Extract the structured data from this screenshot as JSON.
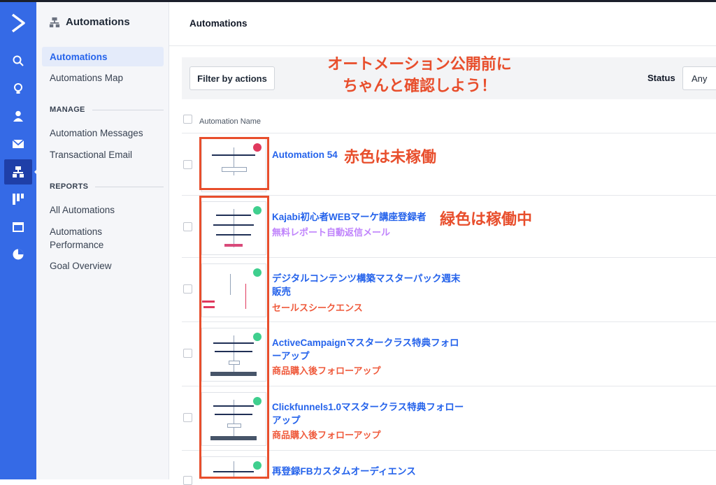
{
  "sidebar": {
    "title": "Automations",
    "items": [
      {
        "label": "Automations",
        "active": true
      },
      {
        "label": "Automations Map"
      }
    ],
    "manage_heading": "MANAGE",
    "manage_items": [
      "Automation Messages",
      "Transactional Email"
    ],
    "reports_heading": "REPORTS",
    "reports_items": [
      "All Automations",
      "Automations Performance",
      "Goal Overview"
    ]
  },
  "rail_icons": [
    "activecampaign-logo",
    "search-icon",
    "lightbulb-icon",
    "contacts-icon",
    "email-icon",
    "automations-icon",
    "pipeline-icon",
    "website-icon",
    "reports-icon"
  ],
  "page": {
    "title": "Automations"
  },
  "filter": {
    "button": "Filter by actions",
    "status_label": "Status",
    "status_value": "Any"
  },
  "table": {
    "column_name": "Automation Name"
  },
  "annotations": {
    "top_line1": "オートメーション公開前に",
    "top_line2": "ちゃんと確認しよう！",
    "red_note": "赤色は未稼働",
    "green_note": "緑色は稼働中"
  },
  "colors": {
    "accent": "#356ae6",
    "link": "#2563eb",
    "annotation": "#e84e2c",
    "inactive": "#e0395d",
    "active": "#3fcf8e"
  },
  "rows": [
    {
      "name": "Automation 54",
      "label": "",
      "status": "inactive"
    },
    {
      "name": "Kajabi初心者WEBマーケ講座登録者",
      "label": "無料レポート自動返信メール",
      "label_color": "#c084fc",
      "status": "active"
    },
    {
      "name": "デジタルコンテンツ構築マスターパック週末販売",
      "label": "セールスシークエンス",
      "label_color": "#ef5a3c",
      "status": "active"
    },
    {
      "name": "ActiveCampaignマスタークラス特典フォローアップ",
      "label": "商品購入後フォローアップ",
      "label_color": "#ef5a3c",
      "status": "active"
    },
    {
      "name": "Clickfunnels1.0マスタークラス特典フォローアップ",
      "label": "商品購入後フォローアップ",
      "label_color": "#ef5a3c",
      "status": "active"
    },
    {
      "name": "再登録FBカスタムオーディエンス",
      "label": "",
      "status": "active"
    }
  ]
}
